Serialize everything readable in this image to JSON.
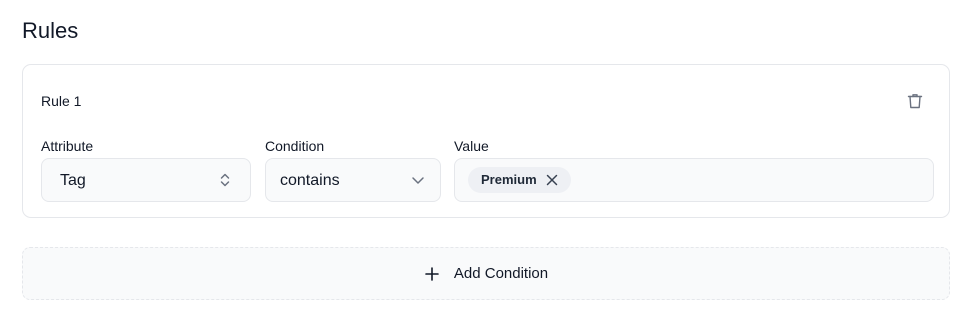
{
  "page": {
    "title": "Rules"
  },
  "rule": {
    "title": "Rule 1",
    "delete_icon": "trash-icon",
    "attribute": {
      "label": "Attribute",
      "value": "Tag",
      "icon": "chevron-up-down-icon"
    },
    "condition": {
      "label": "Condition",
      "value": "contains",
      "icon": "chevron-down-icon"
    },
    "value": {
      "label": "Value",
      "chips": [
        {
          "label": "Premium",
          "remove_icon": "close-icon"
        }
      ]
    }
  },
  "add_condition": {
    "label": "Add Condition",
    "icon": "plus-icon"
  },
  "colors": {
    "border": "#e5e7eb",
    "field_bg": "#f9fafb",
    "chip_bg": "#eef0f4",
    "text": "#111827",
    "icon": "#6b7280"
  }
}
